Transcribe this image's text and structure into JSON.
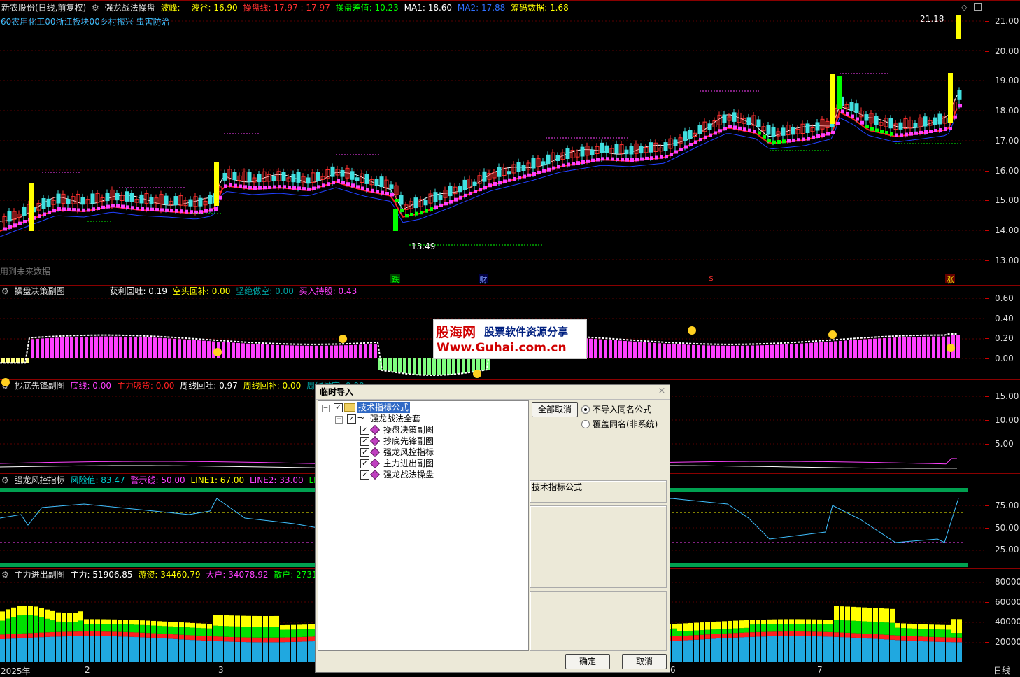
{
  "main": {
    "title": "新农股份(日线,前复权)",
    "indicator": "强龙战法操盘",
    "items": [
      {
        "label": "波峰: -",
        "color": "#ffff00"
      },
      {
        "label": "波谷: 16.90",
        "color": "#ffff00"
      },
      {
        "label": "操盘线: 17.97 : 17.97",
        "color": "#ff3030"
      },
      {
        "label": "操盘差值: 10.23",
        "color": "#00ff00"
      },
      {
        "label": "MA1: 18.60",
        "color": "#ffffff"
      },
      {
        "label": "MA2: 17.88",
        "color": "#3070ff"
      },
      {
        "label": "筹码数据: 1.68",
        "color": "#ffff00"
      }
    ],
    "concepts": "60农用化工00浙江板块00乡村振兴 虫害防治",
    "low_label": "13.49",
    "high_label": "21.18",
    "notice": "用到未来数据",
    "markers": [
      "跌",
      "财",
      "$",
      "涨"
    ],
    "yticks": [
      "21.00",
      "20.00",
      "19.00",
      "18.00",
      "17.00",
      "16.00",
      "15.00",
      "14.00",
      "13.00"
    ]
  },
  "panel1": {
    "title": "操盘决策副图",
    "items": [
      {
        "label": "获利回吐: 0.19",
        "color": "#ffffff"
      },
      {
        "label": "空头回补: 0.00",
        "color": "#ffff00"
      },
      {
        "label": "坚绝做空: 0.00",
        "color": "#00a0a0"
      },
      {
        "label": "买入持股: 0.43",
        "color": "#ff40ff"
      }
    ],
    "yticks": [
      "0.60",
      "0.40",
      "0.20",
      "0.00"
    ]
  },
  "panel2": {
    "title": "抄底先锋副图",
    "items": [
      {
        "label": "底线: 0.00",
        "color": "#ff40ff"
      },
      {
        "label": "主力吸货: 0.00",
        "color": "#ff2020"
      },
      {
        "label": "周线回吐: 0.97",
        "color": "#ffffff"
      },
      {
        "label": "周线回补: 0.00",
        "color": "#ffff00"
      },
      {
        "label": "周线做空: 0.00",
        "color": "#00a0a0"
      }
    ],
    "yticks": [
      "15.00",
      "10.00",
      "5.00"
    ]
  },
  "panel3": {
    "title": "强龙风控指标",
    "items": [
      {
        "label": "风险值: 83.47",
        "color": "#00d0d0"
      },
      {
        "label": "警示线: 50.00",
        "color": "#ff40ff"
      },
      {
        "label": "LINE1: 67.00",
        "color": "#ffff00"
      },
      {
        "label": "LINE2: 33.00",
        "color": "#ff40ff"
      },
      {
        "label": "LINE3: 9",
        "color": "#00ff00"
      }
    ],
    "yticks": [
      "75.00",
      "50.00",
      "25.00"
    ]
  },
  "panel4": {
    "title": "主力进出副图",
    "items": [
      {
        "label": "主力: 51906.85",
        "color": "#ffffff"
      },
      {
        "label": "游资: 34460.79",
        "color": "#ffff00"
      },
      {
        "label": "大户: 34078.92",
        "color": "#ff40ff"
      },
      {
        "label": "散户: 27315.43",
        "color": "#00ff00"
      },
      {
        "label": "主",
        "color": "#ffff00"
      }
    ],
    "yticks": [
      "80000",
      "60000",
      "40000",
      "20000"
    ]
  },
  "xaxis": {
    "labels": [
      "2025年",
      "2",
      "3",
      "6",
      "7"
    ],
    "period": "日线"
  },
  "watermark": {
    "brand": "股海网",
    "slogan": "股票软件资源分享",
    "url": "Www.Guhai.com.cn"
  },
  "dialog": {
    "title": "临时导入",
    "close": "×",
    "root": "技术指标公式",
    "suite": "强龙战法全套",
    "children": [
      "操盘决策副图",
      "抄底先锋副图",
      "强龙风控指标",
      "主力进出副图",
      "强龙战法操盘"
    ],
    "deselect_all": "全部取消",
    "option_skip": "不导入同名公式",
    "option_overwrite": "覆盖同名(非系统)",
    "info_label": "技术指标公式",
    "ok": "确定",
    "cancel": "取消"
  },
  "colors": {
    "up": "#ff3030",
    "down": "#40e0e0",
    "magenta": "#ff40ff",
    "yellow": "#ffff00",
    "green": "#00ff00",
    "grid": "#8a0000"
  }
}
